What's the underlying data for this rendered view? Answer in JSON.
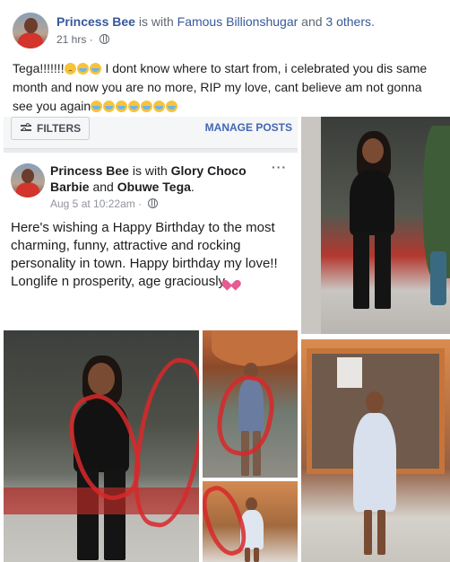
{
  "post": {
    "author": "Princess Bee",
    "with_text": "is with",
    "tagged_primary": "Famous Billionshugar",
    "and_text": "and",
    "tagged_others": "3 others.",
    "more_icon": "more-dots-icon",
    "time": "21 hrs",
    "privacy_icon": "globe-icon",
    "message": "Tega!!!!!!!",
    "message_body": " I dont know where to start from, i celebrated you dis same month and now you are no more, RIP my love, cant believe am not gonna see you again"
  },
  "toolbar": {
    "filters_label": "FILTERS",
    "filters_icon": "sliders-icon",
    "manage_label": "MANAGE POSTS"
  },
  "inner_post": {
    "author": "Princess Bee",
    "with_text": "is with",
    "tagged_1": "Glory Choco Barbie",
    "and_text": "and",
    "tagged_2": "Obuwe Tega",
    "time": "Aug 5 at 10:22am",
    "text": "Here's wishing a Happy Birthday to the most charming, funny, attractive and rocking personality in town. Happy birthday my love!! Longlife n prosperity, age graciously",
    "heart_icon": "heart-icon"
  },
  "colors": {
    "link_blue": "#365899",
    "button_blue": "#4267b2",
    "meta_gray": "#616770",
    "scribble_red": "#d8282a"
  }
}
